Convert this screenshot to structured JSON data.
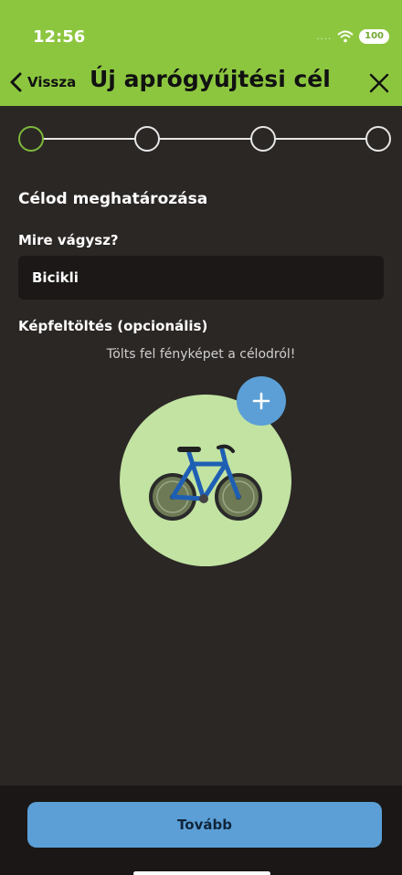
{
  "status_bar": {
    "time": "12:56",
    "signal": "....",
    "battery": "100"
  },
  "nav": {
    "back_label": "Vissza",
    "title": "Új aprógyűjtési cél",
    "back_icon": "chevron-left-icon",
    "close_icon": "close-icon"
  },
  "stepper": {
    "total_steps": 4,
    "current_step": 1
  },
  "form": {
    "section_title": "Célod meghatározása",
    "goal_label": "Mire vágysz?",
    "goal_value": "Bicikli",
    "upload_label": "Képfeltöltés (opcionális)",
    "upload_hint": "Tölts fel fényképet a célodról!",
    "add_photo_icon": "plus-icon",
    "photo_icon": "bicycle-icon"
  },
  "footer": {
    "next_label": "Tovább"
  },
  "colors": {
    "header": "#8cc63f",
    "background": "#2b2725",
    "accent_blue": "#5b9fd6",
    "photo_circle": "#c2e3a2",
    "active_step": "#7db83a"
  }
}
